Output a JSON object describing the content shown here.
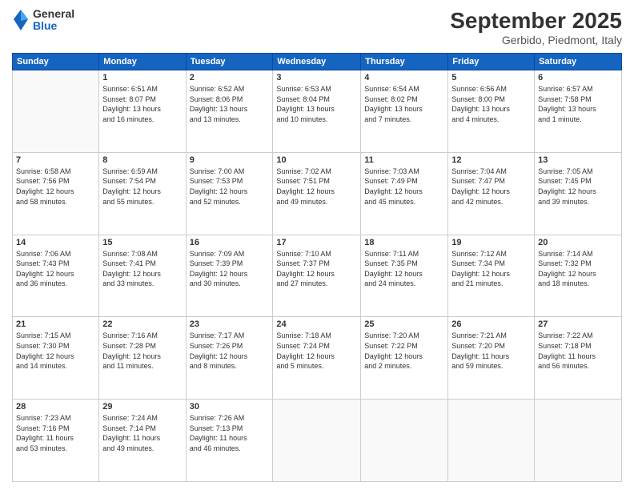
{
  "logo": {
    "general": "General",
    "blue": "Blue"
  },
  "header": {
    "month": "September 2025",
    "location": "Gerbido, Piedmont, Italy"
  },
  "days_of_week": [
    "Sunday",
    "Monday",
    "Tuesday",
    "Wednesday",
    "Thursday",
    "Friday",
    "Saturday"
  ],
  "weeks": [
    [
      {
        "day": "",
        "info": ""
      },
      {
        "day": "1",
        "info": "Sunrise: 6:51 AM\nSunset: 8:07 PM\nDaylight: 13 hours\nand 16 minutes."
      },
      {
        "day": "2",
        "info": "Sunrise: 6:52 AM\nSunset: 8:06 PM\nDaylight: 13 hours\nand 13 minutes."
      },
      {
        "day": "3",
        "info": "Sunrise: 6:53 AM\nSunset: 8:04 PM\nDaylight: 13 hours\nand 10 minutes."
      },
      {
        "day": "4",
        "info": "Sunrise: 6:54 AM\nSunset: 8:02 PM\nDaylight: 13 hours\nand 7 minutes."
      },
      {
        "day": "5",
        "info": "Sunrise: 6:56 AM\nSunset: 8:00 PM\nDaylight: 13 hours\nand 4 minutes."
      },
      {
        "day": "6",
        "info": "Sunrise: 6:57 AM\nSunset: 7:58 PM\nDaylight: 13 hours\nand 1 minute."
      }
    ],
    [
      {
        "day": "7",
        "info": "Sunrise: 6:58 AM\nSunset: 7:56 PM\nDaylight: 12 hours\nand 58 minutes."
      },
      {
        "day": "8",
        "info": "Sunrise: 6:59 AM\nSunset: 7:54 PM\nDaylight: 12 hours\nand 55 minutes."
      },
      {
        "day": "9",
        "info": "Sunrise: 7:00 AM\nSunset: 7:53 PM\nDaylight: 12 hours\nand 52 minutes."
      },
      {
        "day": "10",
        "info": "Sunrise: 7:02 AM\nSunset: 7:51 PM\nDaylight: 12 hours\nand 49 minutes."
      },
      {
        "day": "11",
        "info": "Sunrise: 7:03 AM\nSunset: 7:49 PM\nDaylight: 12 hours\nand 45 minutes."
      },
      {
        "day": "12",
        "info": "Sunrise: 7:04 AM\nSunset: 7:47 PM\nDaylight: 12 hours\nand 42 minutes."
      },
      {
        "day": "13",
        "info": "Sunrise: 7:05 AM\nSunset: 7:45 PM\nDaylight: 12 hours\nand 39 minutes."
      }
    ],
    [
      {
        "day": "14",
        "info": "Sunrise: 7:06 AM\nSunset: 7:43 PM\nDaylight: 12 hours\nand 36 minutes."
      },
      {
        "day": "15",
        "info": "Sunrise: 7:08 AM\nSunset: 7:41 PM\nDaylight: 12 hours\nand 33 minutes."
      },
      {
        "day": "16",
        "info": "Sunrise: 7:09 AM\nSunset: 7:39 PM\nDaylight: 12 hours\nand 30 minutes."
      },
      {
        "day": "17",
        "info": "Sunrise: 7:10 AM\nSunset: 7:37 PM\nDaylight: 12 hours\nand 27 minutes."
      },
      {
        "day": "18",
        "info": "Sunrise: 7:11 AM\nSunset: 7:35 PM\nDaylight: 12 hours\nand 24 minutes."
      },
      {
        "day": "19",
        "info": "Sunrise: 7:12 AM\nSunset: 7:34 PM\nDaylight: 12 hours\nand 21 minutes."
      },
      {
        "day": "20",
        "info": "Sunrise: 7:14 AM\nSunset: 7:32 PM\nDaylight: 12 hours\nand 18 minutes."
      }
    ],
    [
      {
        "day": "21",
        "info": "Sunrise: 7:15 AM\nSunset: 7:30 PM\nDaylight: 12 hours\nand 14 minutes."
      },
      {
        "day": "22",
        "info": "Sunrise: 7:16 AM\nSunset: 7:28 PM\nDaylight: 12 hours\nand 11 minutes."
      },
      {
        "day": "23",
        "info": "Sunrise: 7:17 AM\nSunset: 7:26 PM\nDaylight: 12 hours\nand 8 minutes."
      },
      {
        "day": "24",
        "info": "Sunrise: 7:18 AM\nSunset: 7:24 PM\nDaylight: 12 hours\nand 5 minutes."
      },
      {
        "day": "25",
        "info": "Sunrise: 7:20 AM\nSunset: 7:22 PM\nDaylight: 12 hours\nand 2 minutes."
      },
      {
        "day": "26",
        "info": "Sunrise: 7:21 AM\nSunset: 7:20 PM\nDaylight: 11 hours\nand 59 minutes."
      },
      {
        "day": "27",
        "info": "Sunrise: 7:22 AM\nSunset: 7:18 PM\nDaylight: 11 hours\nand 56 minutes."
      }
    ],
    [
      {
        "day": "28",
        "info": "Sunrise: 7:23 AM\nSunset: 7:16 PM\nDaylight: 11 hours\nand 53 minutes."
      },
      {
        "day": "29",
        "info": "Sunrise: 7:24 AM\nSunset: 7:14 PM\nDaylight: 11 hours\nand 49 minutes."
      },
      {
        "day": "30",
        "info": "Sunrise: 7:26 AM\nSunset: 7:13 PM\nDaylight: 11 hours\nand 46 minutes."
      },
      {
        "day": "",
        "info": ""
      },
      {
        "day": "",
        "info": ""
      },
      {
        "day": "",
        "info": ""
      },
      {
        "day": "",
        "info": ""
      }
    ]
  ]
}
